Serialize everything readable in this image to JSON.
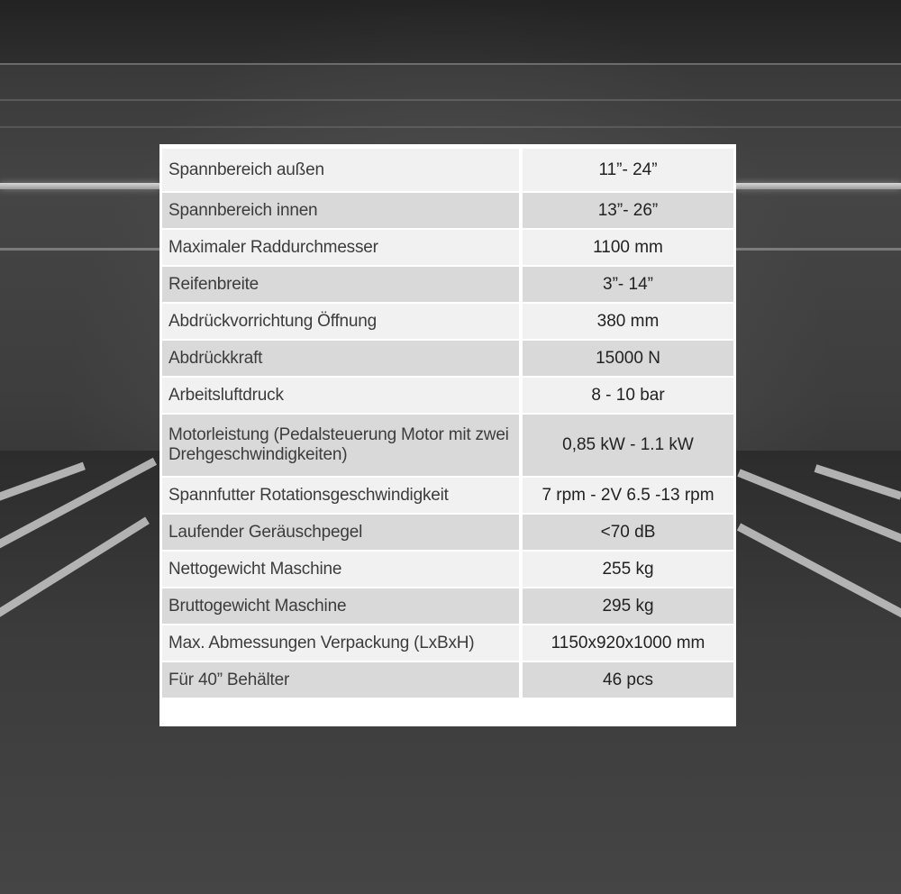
{
  "background": {
    "scene": "parking-garage-photo",
    "tone": "grayscale"
  },
  "spec_table": {
    "rows": [
      {
        "label": "Spannbereich außen",
        "value": "11”- 24”"
      },
      {
        "label": "Spannbereich innen",
        "value": "13”- 26”"
      },
      {
        "label": "Maximaler Raddurchmesser",
        "value": "1100 mm"
      },
      {
        "label": "Reifenbreite",
        "value": "3”- 14”"
      },
      {
        "label": "Abdrückvorrichtung Öffnung",
        "value": "380 mm"
      },
      {
        "label": "Abdrückkraft",
        "value": "15000 N"
      },
      {
        "label": "Arbeitsluftdruck",
        "value": "8 - 10 bar"
      },
      {
        "label": "Motorleistung (Pedalsteuerung Motor mit zwei Drehgeschwindigkeiten)",
        "value": "0,85 kW - 1.1 kW"
      },
      {
        "label": "Spannfutter Rotationsgeschwindigkeit",
        "value": "7 rpm - 2V 6.5 -13 rpm"
      },
      {
        "label": "Laufender Geräuschpegel",
        "value": "<70 dB"
      },
      {
        "label": "Nettogewicht Maschine",
        "value": "255 kg"
      },
      {
        "label": "Bruttogewicht Maschine",
        "value": "295 kg"
      },
      {
        "label": "Max. Abmessungen Verpackung (LxBxH)",
        "value": "1150x920x1000 mm"
      },
      {
        "label": "Für 40” Behälter",
        "value": "46 pcs"
      }
    ]
  },
  "colors": {
    "row_light": "#f1f1f1",
    "row_dark": "#d9d9d9",
    "table_bg": "#ffffff",
    "text": "#3c3c3c"
  }
}
